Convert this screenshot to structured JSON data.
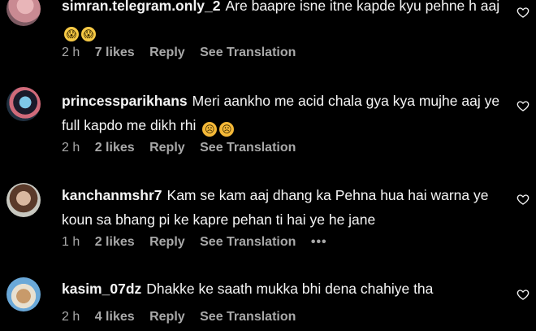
{
  "comments": [
    {
      "username": "simran.telegram.only_2",
      "text": "Are baapre isne itne kapde kyu pehne h aaj",
      "emojis": [
        "😱",
        "😱"
      ],
      "time": "2 h",
      "likes": "7 likes",
      "reply": "Reply",
      "translation": "See Translation"
    },
    {
      "username": "princessparikhans",
      "text": "Meri aankho me acid chala gya kya mujhe aaj ye full kapdo me dikh rhi",
      "emojis": [
        "☹",
        "☹"
      ],
      "time": "2 h",
      "likes": "2 likes",
      "reply": "Reply",
      "translation": "See Translation"
    },
    {
      "username": "kanchanmshr7",
      "text": "Kam se kam aaj dhang ka Pehna hua hai warna ye koun sa bhang pi ke kapre pehan ti hai ye he jane",
      "time": "1 h",
      "likes": "2 likes",
      "reply": "Reply",
      "translation": "See Translation",
      "more": "•••"
    },
    {
      "username": "kasim_07dz",
      "text": "Dhakke ke saath mukka bhi dena chahiye tha",
      "time": "2 h",
      "likes": "4 likes",
      "reply": "Reply",
      "translation": "See Translation"
    }
  ],
  "icons": {
    "like": "heart-outline-icon"
  },
  "colors": {
    "background": "#000000",
    "text": "#f5f5f5",
    "meta": "#a8a8a8"
  }
}
